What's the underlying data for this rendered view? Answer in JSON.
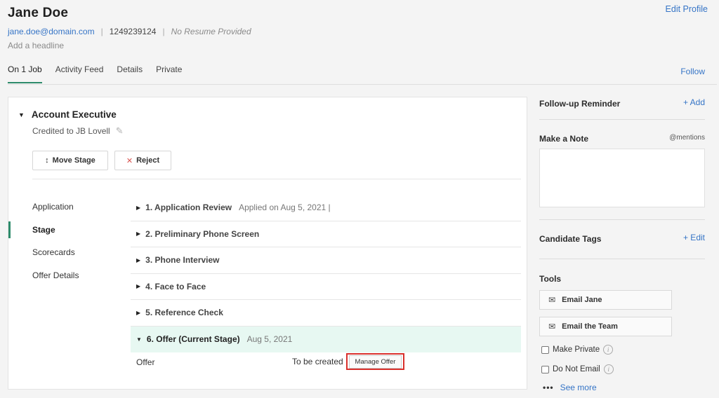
{
  "candidate": {
    "name": "Jane Doe",
    "email": "jane.doe@domain.com",
    "phone": "1249239124",
    "resume": "No Resume Provided",
    "headline_placeholder": "Add a headline",
    "edit_profile": "Edit Profile"
  },
  "tabs": [
    {
      "label": "On 1 Job",
      "active": true
    },
    {
      "label": "Activity Feed",
      "active": false
    },
    {
      "label": "Details",
      "active": false
    },
    {
      "label": "Private",
      "active": false
    }
  ],
  "follow_label": "Follow",
  "job": {
    "title": "Account Executive",
    "credited": "Credited to JB Lovell",
    "move_stage": "Move Stage",
    "reject": "Reject"
  },
  "side_nav": [
    {
      "label": "Application",
      "active": false
    },
    {
      "label": "Stage",
      "active": true
    },
    {
      "label": "Scorecards",
      "active": false
    },
    {
      "label": "Offer Details",
      "active": false
    }
  ],
  "stages": [
    {
      "title": "1. Application Review",
      "meta": "Applied on Aug 5, 2021 |",
      "expanded": false,
      "current": false
    },
    {
      "title": "2. Preliminary Phone Screen",
      "meta": "",
      "expanded": false,
      "current": false
    },
    {
      "title": "3. Phone Interview",
      "meta": "",
      "expanded": false,
      "current": false
    },
    {
      "title": "4. Face to Face",
      "meta": "",
      "expanded": false,
      "current": false
    },
    {
      "title": "5. Reference Check",
      "meta": "",
      "expanded": false,
      "current": false
    },
    {
      "title": "6. Offer (Current Stage)",
      "meta": "Aug 5, 2021",
      "expanded": true,
      "current": true
    }
  ],
  "offer": {
    "label": "Offer",
    "status": "To be created",
    "manage_button": "Manage Offer"
  },
  "right_panel": {
    "follow_up_title": "Follow-up Reminder",
    "follow_up_add": "+ Add",
    "note_title": "Make a Note",
    "note_mentions": "@mentions",
    "tags_title": "Candidate Tags",
    "tags_edit": "+ Edit",
    "tools_title": "Tools",
    "email_candidate": "Email Jane",
    "email_team": "Email the Team",
    "make_private": "Make Private",
    "do_not_email": "Do Not Email",
    "see_more": "See more"
  },
  "colors": {
    "accent_green": "#2e8b6b",
    "link_blue": "#3574c6",
    "current_stage_bg": "#e7f8f2",
    "highlight_red": "#d9302c"
  }
}
